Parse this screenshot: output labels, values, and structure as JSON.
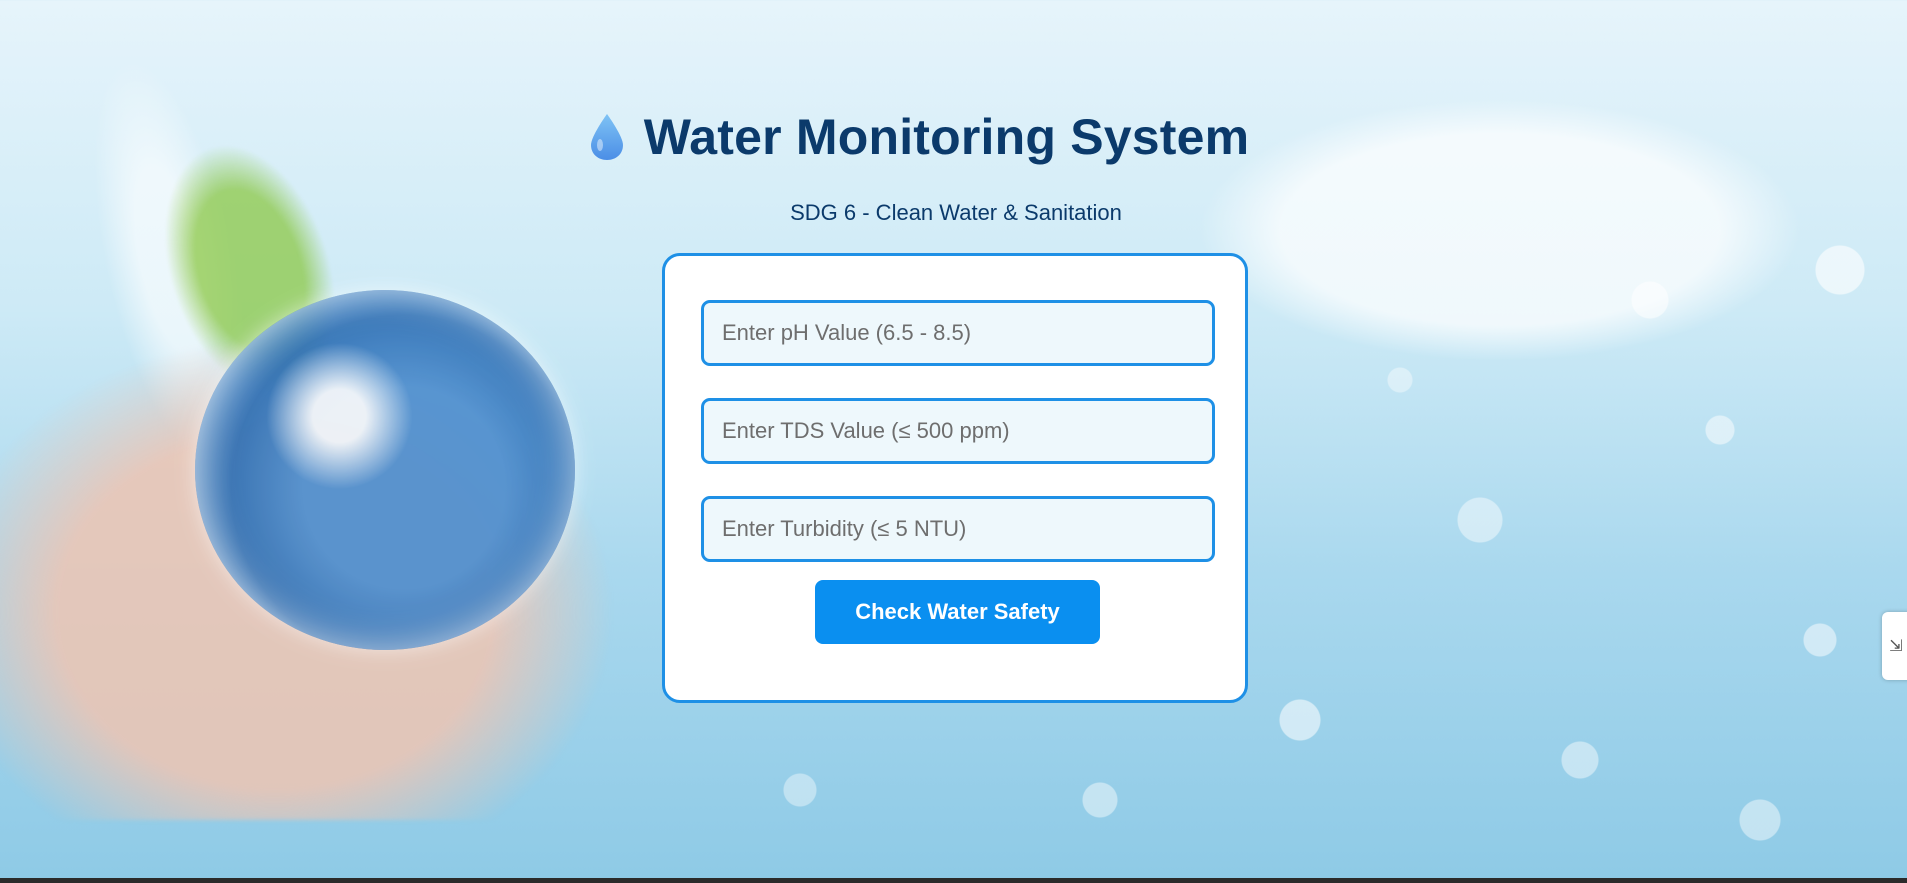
{
  "header": {
    "icon": "water-drop-icon",
    "title": "Water Monitoring System",
    "subtitle": "SDG 6 - Clean Water & Sanitation"
  },
  "form": {
    "ph_placeholder": "Enter pH Value (6.5 - 8.5)",
    "tds_placeholder": "Enter TDS Value (≤ 500 ppm)",
    "turbidity_placeholder": "Enter Turbidity (≤ 5 NTU)",
    "ph_value": "",
    "tds_value": "",
    "turbidity_value": "",
    "submit_label": "Check Water Safety"
  },
  "side_tab": {
    "icon": "side-panel-handle-icon"
  },
  "colors": {
    "accent": "#1e90e6",
    "button": "#0a8ff0",
    "title": "#0b3a6b",
    "field_bg": "#eef8fc"
  }
}
